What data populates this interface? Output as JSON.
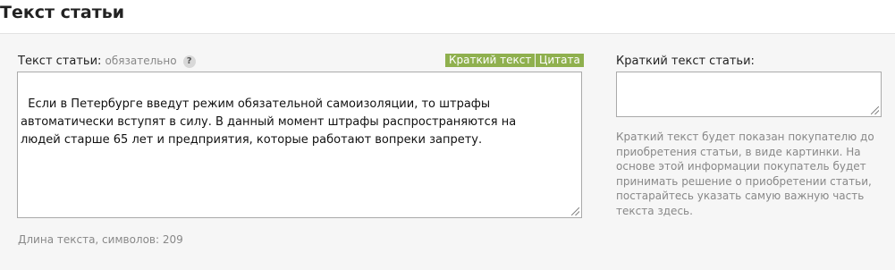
{
  "page": {
    "title": "Текст статьи"
  },
  "article": {
    "label": "Текст статьи:",
    "required_note": "обязательно",
    "help_icon": "?",
    "buttons": {
      "short_text": "Краткий текст",
      "quote": "Цитата"
    },
    "text": "Если в Петербурге введут режим обязательной самоизоляции, то штрафы\nавтоматически вступят в силу. В данный момент штрафы распространяются на\nлюдей старше 65 лет и предприятия, которые работают вопреки запрету.",
    "length_label": "Длина текста, символов: 209"
  },
  "summary": {
    "label": "Краткий текст статьи:",
    "value": "",
    "hint": "Краткий текст будет показан покупателю до приобретения статьи, в виде картинки. На основе этой информации покупатель будет принимать решение о приобретении статьи, постарайтесь указать самую важную часть текста здесь."
  },
  "colors": {
    "tag_green": "#8fb04e",
    "panel_bg": "#f6f6f6"
  }
}
